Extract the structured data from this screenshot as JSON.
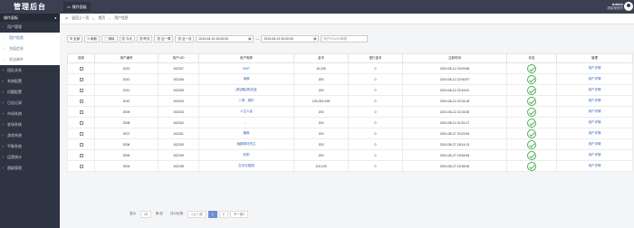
{
  "header": {
    "logo": "管理后台",
    "nav_tab": "操作面板",
    "nav_tab_icon": "monitor-icon",
    "user_name": "Admin",
    "user_sub": "超级管理员"
  },
  "sidebar": {
    "title": "操作面板",
    "title_arrow": "◂",
    "items": [
      {
        "label": "用户管理",
        "type": "group",
        "mark": "−"
      },
      {
        "label": "用户信息",
        "type": "sub",
        "active": true
      },
      {
        "label": "充值信息",
        "type": "sub"
      },
      {
        "label": "发送邮件",
        "type": "sub"
      },
      {
        "label": "团队关系",
        "type": "group",
        "mark": "+"
      },
      {
        "label": "系统配置",
        "type": "group",
        "mark": "+"
      },
      {
        "label": "问题配置",
        "type": "group",
        "mark": "+"
      },
      {
        "label": "日志记录",
        "type": "group",
        "mark": "+"
      },
      {
        "label": "市场系统",
        "type": "group",
        "mark": "+"
      },
      {
        "label": "农场系统",
        "type": "group",
        "mark": "+"
      },
      {
        "label": "游戏系统",
        "type": "group",
        "mark": "+"
      },
      {
        "label": "平衡系统",
        "type": "group",
        "mark": "+"
      },
      {
        "label": "运营统计",
        "type": "group",
        "mark": "+"
      },
      {
        "label": "超级管理",
        "type": "group",
        "mark": "+"
      }
    ]
  },
  "breadcrumb": {
    "back": "返回上一页",
    "home": "首页",
    "current": "用户信息"
  },
  "toolbar": {
    "all": "全部",
    "refresh": "刷新",
    "clear": "清除",
    "today": "今天",
    "yesterday": "昨天",
    "last_week": "近一周",
    "last_month": "近一月",
    "start_date": "2019-06-12 00:00:00",
    "end_date": "2019-06-13 00:00:00",
    "search_placeholder": "账户ID/UID/邮箱"
  },
  "table": {
    "headers": [
      "选择",
      "用户编号",
      "用户UID",
      "用户昵称",
      "金币",
      "银行金币",
      "注册时间",
      "状态",
      "管理"
    ],
    "rows": [
      {
        "id": "2013",
        "uid": "102207",
        "nick": "9997",
        "gold": "10,200",
        "bank": "0",
        "time": "2019-06-12 23:09:56",
        "action": "用户详情"
      },
      {
        "id": "2012",
        "uid": "102206",
        "nick": "海豚",
        "gold": "200",
        "bank": "0",
        "time": "2019-06-12 22:50:57",
        "action": "用户详情"
      },
      {
        "id": "2011",
        "uid": "102205",
        "nick": "[窝][窝][窝]无敌",
        "gold": "200",
        "bank": "0",
        "time": "2019-06-12 22:49:01",
        "action": "用户详情"
      },
      {
        "id": "2010",
        "uid": "102204",
        "nick": "八哥 - 锅炉",
        "gold": "100,000,199",
        "bank": "0",
        "time": "2019-06-12 22:34:18",
        "action": "用户详情"
      },
      {
        "id": "2009",
        "uid": "102203",
        "nick": "人生人民",
        "gold": "200",
        "bank": "0",
        "time": "2019-06-12 22:15:30",
        "action": "用户详情"
      },
      {
        "id": "2008",
        "uid": "102202",
        "nick": "。",
        "gold": "200",
        "bank": "0",
        "time": "2019-06-12 21:51:17",
        "action": "用户详情"
      },
      {
        "id": "2007",
        "uid": "102201",
        "nick": "隆离",
        "gold": "200",
        "bank": "0",
        "time": "2019-05-27 20:22:54",
        "action": "用户详情"
      },
      {
        "id": "2006",
        "uid": "102200",
        "nick": "幽娜清河先生",
        "gold": "200",
        "bank": "0",
        "time": "2019-05-27 18:14:13",
        "action": "用户详情"
      },
      {
        "id": "2005",
        "uid": "102199",
        "nick": "彩阳",
        "gold": "200",
        "bank": "0",
        "time": "2019-05-27 15:54:59",
        "action": "用户详情"
      },
      {
        "id": "2004",
        "uid": "102198",
        "nick": "生存在团团",
        "gold": "110,100",
        "bank": "0",
        "time": "2019-05-27 15:38:26",
        "action": "用户详情"
      }
    ]
  },
  "pagination": {
    "show": "显示",
    "per_page": "10",
    "unit": "条/页",
    "total": "共13记录",
    "prev": "上一页",
    "page1": "1",
    "page2": "2",
    "next": "下一页"
  }
}
